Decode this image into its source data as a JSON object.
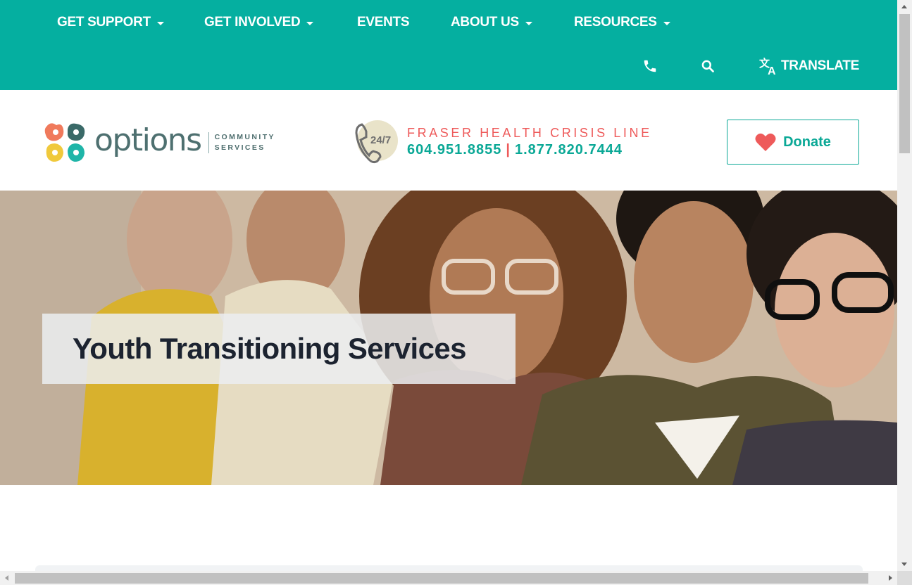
{
  "colors": {
    "teal": "#05afa0",
    "coral": "#ee5a5a",
    "dark_text": "#1c2330"
  },
  "nav": {
    "items": [
      {
        "label": "GET SUPPORT",
        "has_dropdown": true
      },
      {
        "label": "GET INVOLVED",
        "has_dropdown": true
      },
      {
        "label": "EVENTS",
        "has_dropdown": false
      },
      {
        "label": "ABOUT US",
        "has_dropdown": true
      },
      {
        "label": "RESOURCES",
        "has_dropdown": true
      }
    ],
    "phone_icon": "phone-icon",
    "search_icon": "search-icon",
    "translate_icon": "translate-icon",
    "translate_label": "TRANSLATE"
  },
  "header": {
    "logo": {
      "word": "options",
      "sub_line1": "COMMUNITY",
      "sub_line2": "SERVICES"
    },
    "crisis": {
      "badge": "24/7",
      "title": "FRASER HEALTH CRISIS LINE",
      "phone1": "604.951.8855",
      "separator": "|",
      "phone2": "1.877.820.7444"
    },
    "donate_label": "Donate"
  },
  "hero": {
    "title": "Youth Transitioning Services"
  }
}
